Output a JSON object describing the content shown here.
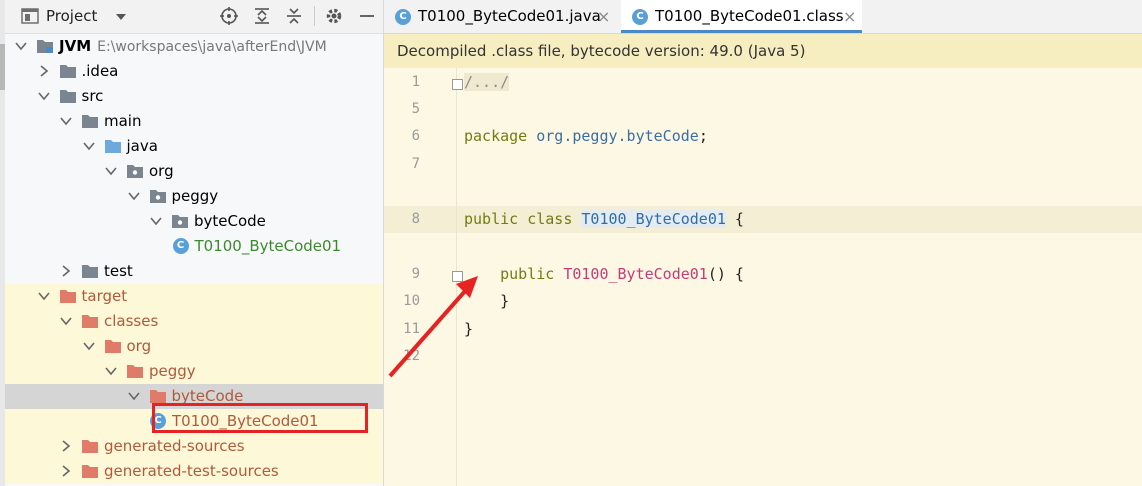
{
  "project_panel": {
    "title": "Project",
    "tree": [
      {
        "label": "JVM",
        "detail": "E:\\workspaces\\java\\afterEnd\\JVM",
        "depth": 0,
        "expanded": true,
        "icon": "module-folder-icon",
        "bold": true
      },
      {
        "label": ".idea",
        "depth": 1,
        "expanded": false,
        "icon": "folder-icon"
      },
      {
        "label": "src",
        "depth": 1,
        "expanded": true,
        "icon": "folder-icon"
      },
      {
        "label": "main",
        "depth": 2,
        "expanded": true,
        "icon": "folder-icon"
      },
      {
        "label": "java",
        "depth": 3,
        "expanded": true,
        "icon": "source-folder-icon"
      },
      {
        "label": "org",
        "depth": 4,
        "expanded": true,
        "icon": "package-icon"
      },
      {
        "label": "peggy",
        "depth": 5,
        "expanded": true,
        "icon": "package-icon"
      },
      {
        "label": "byteCode",
        "depth": 6,
        "expanded": true,
        "icon": "package-icon"
      },
      {
        "label": "T0100_ByteCode01",
        "depth": 7,
        "icon": "class-icon",
        "color": "#3c8a2e"
      },
      {
        "label": "test",
        "depth": 2,
        "expanded": false,
        "icon": "folder-icon"
      },
      {
        "label": "target",
        "depth": 1,
        "expanded": true,
        "icon": "excluded-folder-icon",
        "excluded": true
      },
      {
        "label": "classes",
        "depth": 2,
        "expanded": true,
        "icon": "excluded-folder-icon",
        "excluded": true
      },
      {
        "label": "org",
        "depth": 3,
        "expanded": true,
        "icon": "excluded-folder-icon",
        "excluded": true
      },
      {
        "label": "peggy",
        "depth": 4,
        "expanded": true,
        "icon": "excluded-folder-icon",
        "excluded": true
      },
      {
        "label": "byteCode",
        "depth": 5,
        "expanded": true,
        "icon": "excluded-folder-icon",
        "excluded": true,
        "selected": true
      },
      {
        "label": "T0100_ByteCode01",
        "depth": 6,
        "icon": "class-icon",
        "excluded": true
      },
      {
        "label": "generated-sources",
        "depth": 2,
        "expanded": false,
        "icon": "excluded-folder-icon",
        "excluded": true
      },
      {
        "label": "generated-test-sources",
        "depth": 2,
        "expanded": false,
        "icon": "excluded-folder-icon",
        "excluded": true
      }
    ]
  },
  "editor": {
    "tabs": [
      {
        "label": "T0100_ByteCode01.java",
        "active": false
      },
      {
        "label": "T0100_ByteCode01.class",
        "active": true
      }
    ],
    "banner": "Decompiled .class file, bytecode version: 49.0 (Java 5)",
    "lines": [
      {
        "num": "1",
        "text": "/.../"
      },
      {
        "num": "5",
        "text": ""
      },
      {
        "num": "6",
        "text": "package org.peggy.byteCode;"
      },
      {
        "num": "7",
        "text": ""
      },
      {
        "num": "8",
        "text": "public class T0100_ByteCode01 {"
      },
      {
        "num": "9",
        "text": "    public T0100_ByteCode01() {"
      },
      {
        "num": "10",
        "text": "    }"
      },
      {
        "num": "11",
        "text": "}"
      },
      {
        "num": "12",
        "text": ""
      }
    ]
  },
  "colors": {
    "annotation": "#e52323",
    "excluded_folder": "#e07b6a",
    "folder": "#7b8590",
    "source_folder": "#6fa8dc",
    "accent": "#4a88c7"
  }
}
